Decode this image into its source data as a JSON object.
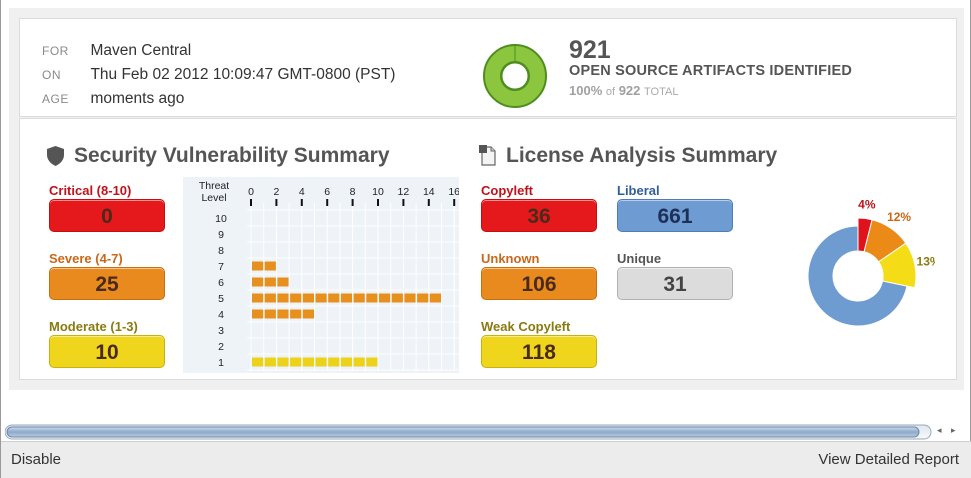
{
  "header": {
    "for_label": "FOR",
    "for_value": "Maven Central",
    "on_label": "ON",
    "on_value": "Thu Feb 02 2012 10:09:47 GMT-0800 (PST)",
    "age_label": "AGE",
    "age_value": "moments ago"
  },
  "artifacts": {
    "count": "921",
    "label": "OPEN SOURCE ARTIFACTS IDENTIFIED",
    "percent": "100%",
    "of": "of",
    "total": "922",
    "total_label": "TOTAL",
    "ring_fraction": 0.999
  },
  "security": {
    "title": "Security Vulnerability Summary",
    "critical": {
      "label": "Critical (8-10)",
      "value": "0"
    },
    "severe": {
      "label": "Severe (4-7)",
      "value": "25"
    },
    "moderate": {
      "label": "Moderate (1-3)",
      "value": "10"
    }
  },
  "chart_data": {
    "type": "bar",
    "orientation": "horizontal",
    "ylabel": "Threat Level",
    "categories": [
      "10",
      "9",
      "8",
      "7",
      "6",
      "5",
      "4",
      "3",
      "2",
      "1"
    ],
    "values": [
      0,
      0,
      0,
      2,
      3,
      15,
      5,
      0,
      0,
      10
    ],
    "xticks": [
      "0",
      "2",
      "4",
      "6",
      "8",
      "10",
      "12",
      "14",
      "16"
    ],
    "xlim": [
      0,
      16
    ],
    "colors": {
      "severe": "#e8901e",
      "moderate": "#ecd21a"
    }
  },
  "license": {
    "title": "License Analysis Summary",
    "copyleft": {
      "label": "Copyleft",
      "value": "36"
    },
    "liberal": {
      "label": "Liberal",
      "value": "661"
    },
    "unknown": {
      "label": "Unknown",
      "value": "106"
    },
    "unique": {
      "label": "Unique",
      "value": "31"
    },
    "weak_copyleft": {
      "label": "Weak Copyleft",
      "value": "118"
    }
  },
  "license_donut": {
    "slices": [
      {
        "name": "Copyleft",
        "percent_label": "4%",
        "value": 36,
        "color": "#e0131c"
      },
      {
        "name": "Unknown",
        "percent_label": "12%",
        "value": 106,
        "color": "#ec8a17"
      },
      {
        "name": "Weak Copyleft",
        "percent_label": "13%",
        "value": 118,
        "color": "#f4dc16"
      },
      {
        "name": "Liberal",
        "percent_label": "",
        "value": 661,
        "color": "#6e9cd1"
      }
    ]
  },
  "footer": {
    "disable": "Disable",
    "report": "View Detailed Report"
  },
  "colors": {
    "critical": "#e5191c",
    "severe": "#e98a1f",
    "moderate": "#efd61c",
    "liberal": "#6e9bd2",
    "unique": "#dcdcdc",
    "ring": "#8cc63f"
  }
}
